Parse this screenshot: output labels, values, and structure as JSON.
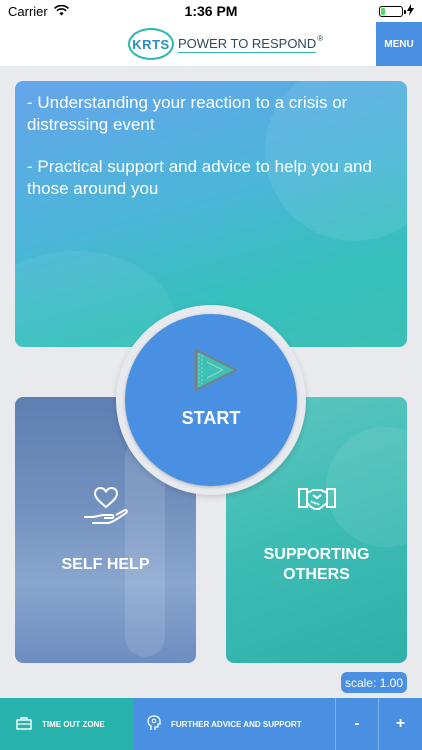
{
  "status_bar": {
    "carrier": "Carrier",
    "time": "1:36 PM",
    "battery_level": 0.2,
    "icons": [
      "wifi-icon",
      "battery-icon",
      "charging-icon"
    ]
  },
  "header": {
    "logo_short": "KRTS",
    "logo_tagline": "POWER TO RESPOND",
    "logo_reg": "®",
    "menu_label": "MENU"
  },
  "info_card": {
    "lines": [
      "- Understanding your reaction to a crisis or distressing event",
      "- Practical support and advice to help you and those around you"
    ]
  },
  "start": {
    "label": "START",
    "icon": "play-icon"
  },
  "self_help": {
    "label": "SELF HELP",
    "icon": "heart-hand-icon"
  },
  "supporting_others": {
    "label_line1": "SUPPORTING",
    "label_line2": "OTHERS",
    "icon": "handshake-icon"
  },
  "scale": {
    "label": "scale: 1.00"
  },
  "bottom_bar": {
    "timeout_label": "TIME OUT ZONE",
    "timeout_icon": "briefcase-icon",
    "advice_label": "FURTHER ADVICE AND SUPPORT",
    "advice_icon": "head-icon",
    "zoom_out": "-",
    "zoom_in": "+"
  },
  "colors": {
    "primary_blue": "#4a90e2",
    "teal": "#27b3ab",
    "background": "#e8eaed"
  }
}
